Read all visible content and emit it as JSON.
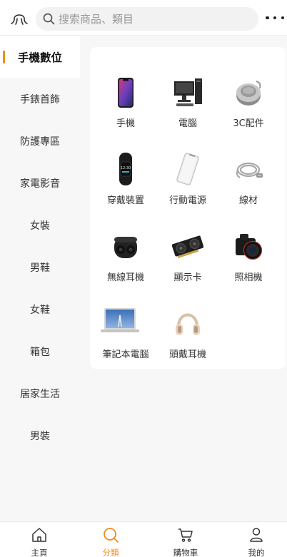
{
  "header": {
    "search_placeholder": "搜索商品、類目",
    "menu_icon": "octopus-menu-icon",
    "more_icon": "more-dots-icon"
  },
  "sidebar": {
    "active_color": "#f08c1b",
    "items": [
      {
        "label": "手機數位",
        "active": true
      },
      {
        "label": "手錶首飾",
        "active": false
      },
      {
        "label": "防護專區",
        "active": false
      },
      {
        "label": "家電影音",
        "active": false
      },
      {
        "label": "女裝",
        "active": false
      },
      {
        "label": "男鞋",
        "active": false
      },
      {
        "label": "女鞋",
        "active": false
      },
      {
        "label": "箱包",
        "active": false
      },
      {
        "label": "居家生活",
        "active": false
      },
      {
        "label": "男裝",
        "active": false
      }
    ]
  },
  "categories": [
    {
      "label": "手機",
      "icon": "smartphone-icon"
    },
    {
      "label": "電腦",
      "icon": "desktop-computer-icon"
    },
    {
      "label": "3C配件",
      "icon": "speaker-accessory-icon"
    },
    {
      "label": "穿戴裝置",
      "icon": "fitness-band-icon"
    },
    {
      "label": "行動電源",
      "icon": "power-bank-icon"
    },
    {
      "label": "線材",
      "icon": "cable-icon"
    },
    {
      "label": "無線耳機",
      "icon": "wireless-earbuds-icon"
    },
    {
      "label": "顯示卡",
      "icon": "graphics-card-icon"
    },
    {
      "label": "照相機",
      "icon": "camera-icon"
    },
    {
      "label": "筆記本電腦",
      "icon": "laptop-icon"
    },
    {
      "label": "頭戴耳機",
      "icon": "headphones-icon"
    }
  ],
  "tabbar": {
    "active_color": "#f08c1b",
    "tabs": [
      {
        "label": "主頁",
        "icon": "home-icon",
        "active": false
      },
      {
        "label": "分類",
        "icon": "category-search-icon",
        "active": true
      },
      {
        "label": "購物車",
        "icon": "cart-icon",
        "active": false
      },
      {
        "label": "我的",
        "icon": "user-icon",
        "active": false
      }
    ]
  }
}
